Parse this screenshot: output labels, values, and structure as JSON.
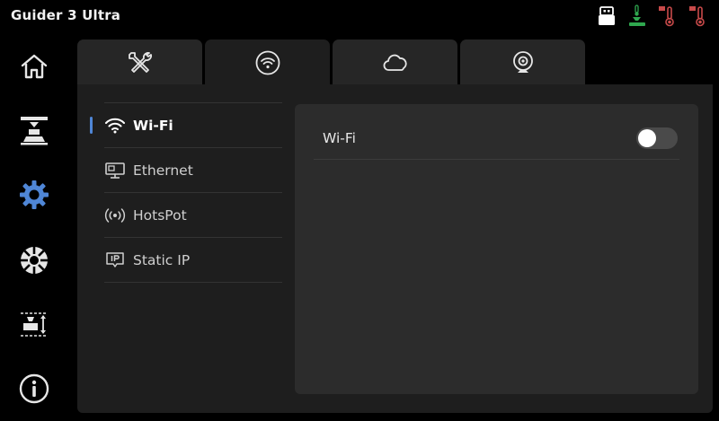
{
  "app": {
    "title": "Guider 3 Ultra"
  },
  "status_icons": [
    "usb-drive-icon",
    "nozzle-temperature-icon",
    "bed-temperature-icon",
    "chamber-temperature-icon"
  ],
  "sidebar": {
    "items": [
      {
        "name": "home",
        "icon": "home-icon"
      },
      {
        "name": "print",
        "icon": "print-job-icon"
      },
      {
        "name": "settings",
        "icon": "gear-icon",
        "active": true
      },
      {
        "name": "filament",
        "icon": "filament-spool-icon"
      },
      {
        "name": "calibration",
        "icon": "calibration-icon"
      },
      {
        "name": "info",
        "icon": "info-icon"
      }
    ]
  },
  "tabs": [
    {
      "name": "tools",
      "icon": "tools-icon"
    },
    {
      "name": "network",
      "icon": "wifi-icon",
      "active": true
    },
    {
      "name": "cloud",
      "icon": "cloud-icon"
    },
    {
      "name": "camera",
      "icon": "camera-icon"
    }
  ],
  "subnav": {
    "items": [
      {
        "label": "Wi-Fi",
        "icon": "wifi-icon",
        "active": true
      },
      {
        "label": "Ethernet",
        "icon": "ethernet-icon"
      },
      {
        "label": "HotsPot",
        "icon": "hotspot-icon"
      },
      {
        "label": "Static IP",
        "icon": "static-ip-icon"
      }
    ]
  },
  "content": {
    "wifi_label": "Wi-Fi",
    "wifi_enabled": false
  },
  "colors": {
    "accent": "#4f86d6",
    "panel": "#1e1e1e",
    "card": "#2c2c2c",
    "tab": "#262626",
    "status_green": "#2fa84f",
    "status_red": "#c84a4a"
  }
}
